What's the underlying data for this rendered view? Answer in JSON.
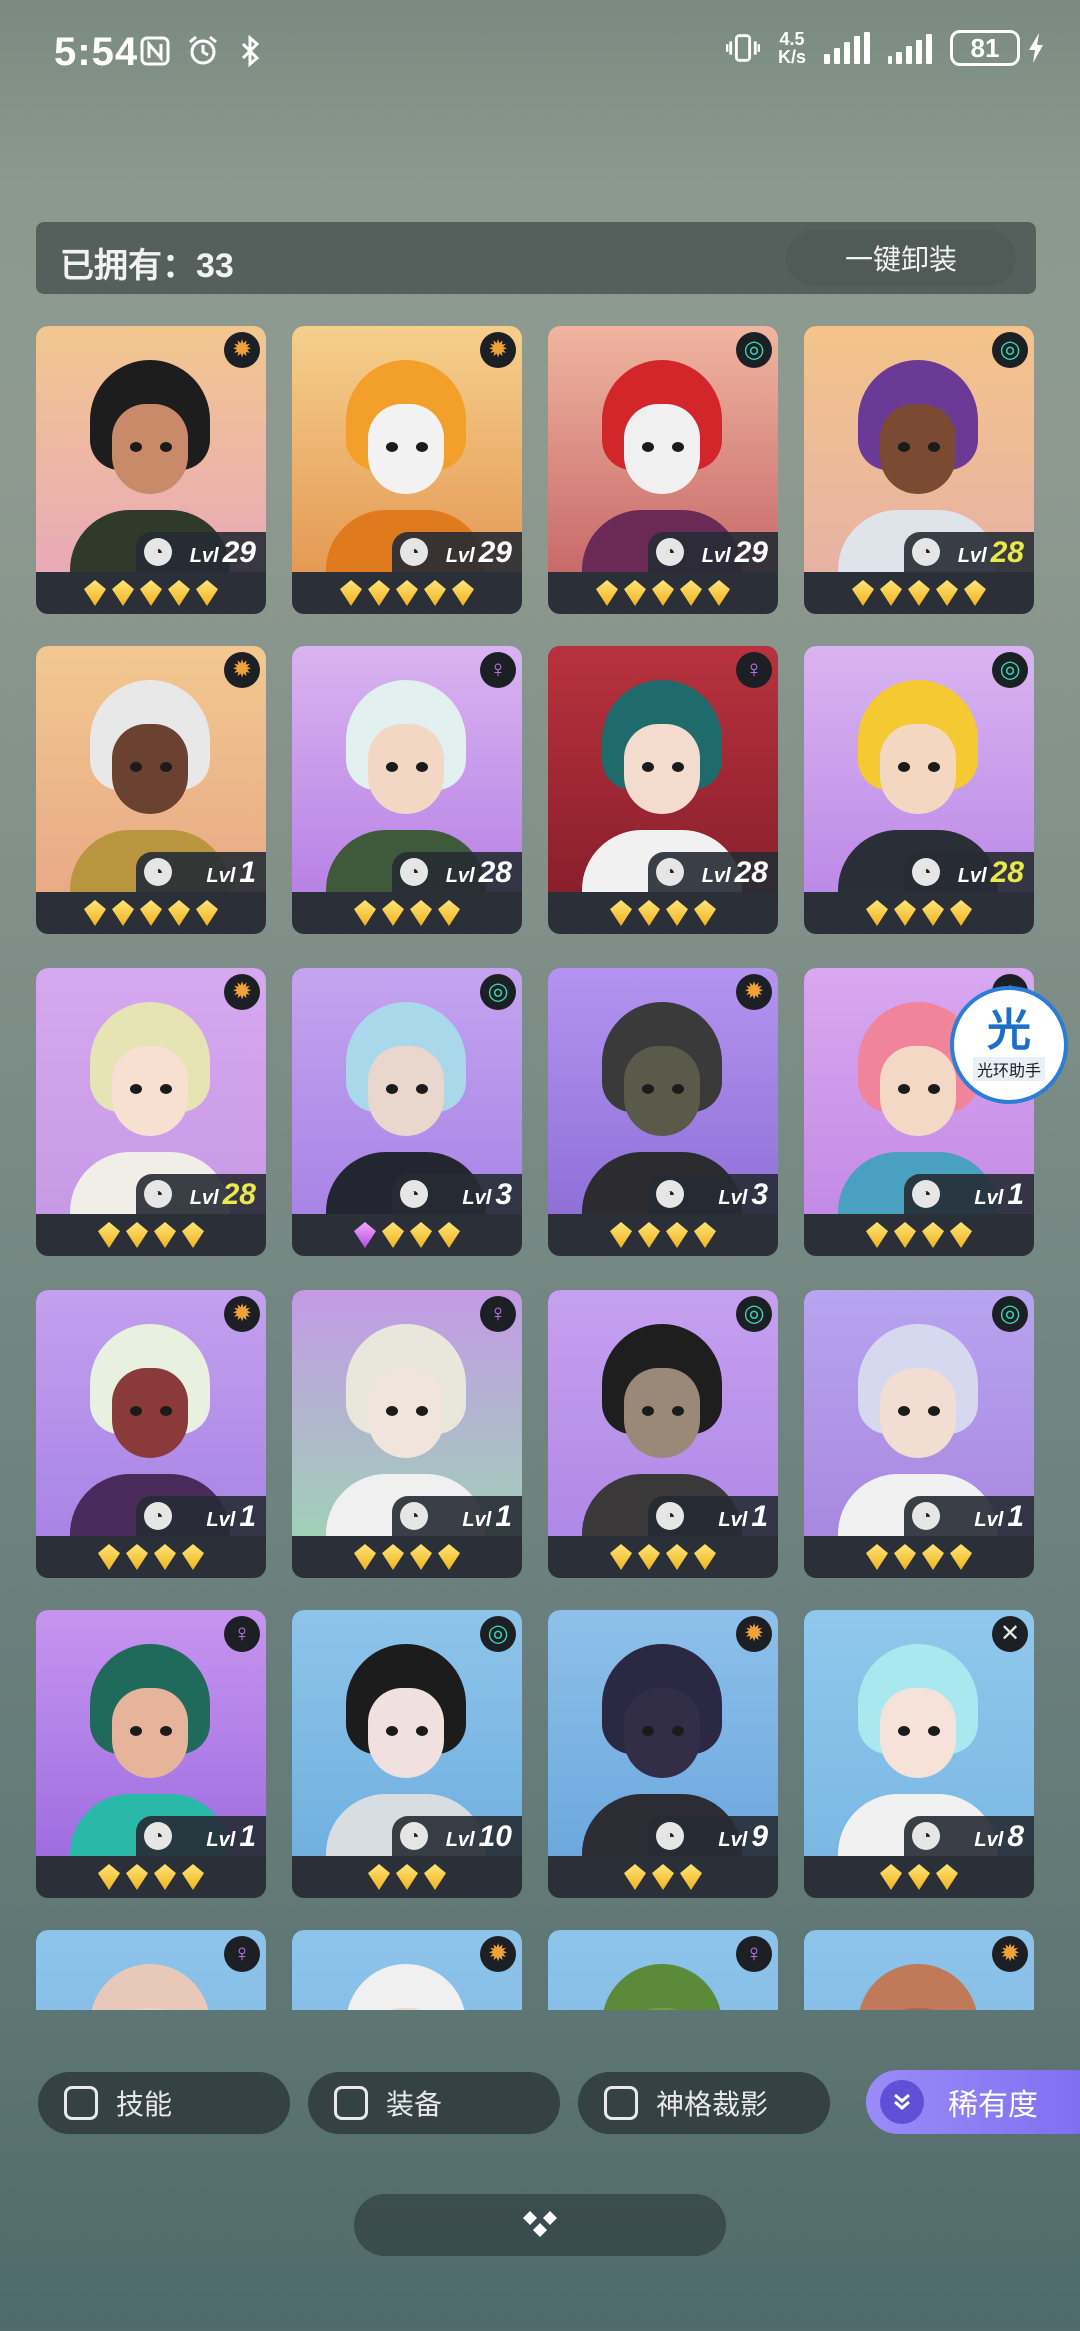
{
  "status_bar": {
    "time": "5:54",
    "net_speed_value": "4.5",
    "net_speed_unit": "K/s",
    "battery": "81",
    "icons": [
      "nfc-icon",
      "alarm-icon",
      "bluetooth-icon",
      "vibrate-icon",
      "signal-icon",
      "signal-icon",
      "charging-icon"
    ]
  },
  "header": {
    "owned_label": "已拥有：33",
    "unequip_label": "一键卸装"
  },
  "colors": {
    "element_sun": "#f0a238",
    "element_wind": "#34d6b4",
    "element_spirit": "#c47bf0",
    "element_x": "#e6e6e6",
    "level_gold": "#e8e94a",
    "rarity_button": "#8a7cf4"
  },
  "cards": [
    {
      "level_prefix": "Lvl",
      "level": "29",
      "element": "sun",
      "stars": 5,
      "purple_stars": 0,
      "gold": false,
      "bg": [
        "#f2c78e",
        "#e9a9b8"
      ],
      "hair": "#1d1d1d",
      "skin": "#c98a6a",
      "body": "#2f3a2a"
    },
    {
      "level_prefix": "Lvl",
      "level": "29",
      "element": "sun",
      "stars": 5,
      "purple_stars": 0,
      "gold": false,
      "bg": [
        "#f6cf8c",
        "#e49a55"
      ],
      "hair": "#f3a02a",
      "skin": "#f2f2f2",
      "body": "#e07a1f"
    },
    {
      "level_prefix": "Lvl",
      "level": "29",
      "element": "wind",
      "stars": 5,
      "purple_stars": 0,
      "gold": false,
      "bg": [
        "#f0b5a0",
        "#c86a6a"
      ],
      "hair": "#d3262b",
      "skin": "#f0f0f0",
      "body": "#6a2a55"
    },
    {
      "level_prefix": "Lvl",
      "level": "28",
      "element": "wind",
      "stars": 5,
      "purple_stars": 0,
      "gold": true,
      "bg": [
        "#f4c48a",
        "#e7b2a4"
      ],
      "hair": "#6b3a96",
      "skin": "#7a4a32",
      "body": "#dfe3ea"
    },
    {
      "level_prefix": "Lvl",
      "level": "1",
      "element": "sun",
      "stars": 5,
      "purple_stars": 0,
      "gold": false,
      "bg": [
        "#f2c890",
        "#e9aa86"
      ],
      "hair": "#e8e8e8",
      "skin": "#6b4232",
      "body": "#b99540"
    },
    {
      "level_prefix": "Lvl",
      "level": "28",
      "element": "spirit",
      "stars": 4,
      "purple_stars": 0,
      "gold": false,
      "bg": [
        "#d9b4f0",
        "#b882e6"
      ],
      "hair": "#e2f0f0",
      "skin": "#f2d7c4",
      "body": "#3f5a3a"
    },
    {
      "level_prefix": "Lvl",
      "level": "28",
      "element": "spirit",
      "stars": 4,
      "purple_stars": 0,
      "gold": false,
      "bg": [
        "#b8323e",
        "#8a1f2c"
      ],
      "hair": "#1f6a6a",
      "skin": "#f3dccd",
      "body": "#f1f1f1"
    },
    {
      "level_prefix": "Lvl",
      "level": "28",
      "element": "wind",
      "stars": 4,
      "purple_stars": 0,
      "gold": true,
      "bg": [
        "#d9b4f0",
        "#bc8ae8"
      ],
      "hair": "#f5c932",
      "skin": "#f4d7c0",
      "body": "#2a2e36"
    },
    {
      "level_prefix": "Lvl",
      "level": "28",
      "element": "sun",
      "stars": 4,
      "purple_stars": 0,
      "gold": true,
      "bg": [
        "#d6a8f0",
        "#c89ae6"
      ],
      "hair": "#e6e3b4",
      "skin": "#f7e0d2",
      "body": "#f0eee6"
    },
    {
      "level_prefix": "Lvl",
      "level": "3",
      "element": "wind",
      "stars": 3,
      "purple_stars": 1,
      "gold": false,
      "bg": [
        "#c4a4f0",
        "#a884e6"
      ],
      "hair": "#a9d8ea",
      "skin": "#e9d6cc",
      "body": "#232630"
    },
    {
      "level_prefix": "Lvl",
      "level": "3",
      "element": "sun",
      "stars": 4,
      "purple_stars": 0,
      "gold": false,
      "bg": [
        "#b494f0",
        "#8f70d8"
      ],
      "hair": "#3a3a3a",
      "skin": "#5a5a4a",
      "body": "#2c2c30"
    },
    {
      "level_prefix": "Lvl",
      "level": "1",
      "element": "spirit",
      "stars": 4,
      "purple_stars": 0,
      "gold": false,
      "bg": [
        "#d9a8f0",
        "#c48ae6"
      ],
      "hair": "#f0849a",
      "skin": "#f3d8c6",
      "body": "#4aa0c0"
    },
    {
      "level_prefix": "Lvl",
      "level": "1",
      "element": "sun",
      "stars": 4,
      "purple_stars": 0,
      "gold": false,
      "bg": [
        "#c4a0f0",
        "#a884e6"
      ],
      "hair": "#e8f0e0",
      "skin": "#8a3a3a",
      "body": "#4a2a5a"
    },
    {
      "level_prefix": "Lvl",
      "level": "1",
      "element": "spirit",
      "stars": 4,
      "purple_stars": 0,
      "gold": false,
      "bg": [
        "#c49ae6",
        "#a0d0b8"
      ],
      "hair": "#e9e7dc",
      "skin": "#f0e4dc",
      "body": "#f0f0f0"
    },
    {
      "level_prefix": "Lvl",
      "level": "1",
      "element": "wind",
      "stars": 4,
      "purple_stars": 0,
      "gold": false,
      "bg": [
        "#c6a0f0",
        "#b088e6"
      ],
      "hair": "#1e1e1e",
      "skin": "#9a8878",
      "body": "#3a3838"
    },
    {
      "level_prefix": "Lvl",
      "level": "1",
      "element": "wind",
      "stars": 4,
      "purple_stars": 0,
      "gold": false,
      "bg": [
        "#b8a4f0",
        "#a888e0"
      ],
      "hair": "#d6d8f0",
      "skin": "#f2ddd2",
      "body": "#f1f1f1"
    },
    {
      "level_prefix": "Lvl",
      "level": "1",
      "element": "spirit",
      "stars": 4,
      "purple_stars": 0,
      "gold": false,
      "bg": [
        "#c894f0",
        "#9e6ee0"
      ],
      "hair": "#1f6a5a",
      "skin": "#e6b49a",
      "body": "#2ab8a8"
    },
    {
      "level_prefix": "Lvl",
      "level": "10",
      "element": "wind",
      "stars": 3,
      "purple_stars": 0,
      "gold": false,
      "bg": [
        "#8ec4ea",
        "#70b0e0"
      ],
      "hair": "#1c1c1c",
      "skin": "#f0e0e0",
      "body": "#d8dde2"
    },
    {
      "level_prefix": "Lvl",
      "level": "9",
      "element": "sun",
      "stars": 3,
      "purple_stars": 0,
      "gold": false,
      "bg": [
        "#8ec0ea",
        "#6ca8de"
      ],
      "hair": "#2a2842",
      "skin": "#322e48",
      "body": "#2c2c34"
    },
    {
      "level_prefix": "Lvl",
      "level": "8",
      "element": "x",
      "stars": 3,
      "purple_stars": 0,
      "gold": false,
      "bg": [
        "#90c8ec",
        "#7ab8e4"
      ],
      "hair": "#a8e8ee",
      "skin": "#f6e2d8",
      "body": "#f1f1f1"
    },
    {
      "level_prefix": "",
      "level": "",
      "element": "spirit",
      "stars": 0,
      "purple_stars": 0,
      "gold": false,
      "bg": [
        "#8ec4ea",
        "#7ab4e2"
      ],
      "hair": "#e8c8b8",
      "skin": "#f0d0c0",
      "body": "#8ec4ea"
    },
    {
      "level_prefix": "",
      "level": "",
      "element": "sun",
      "stars": 0,
      "purple_stars": 0,
      "gold": false,
      "bg": [
        "#8ec4ea",
        "#7ab4e2"
      ],
      "hair": "#f0f0f0",
      "skin": "#f0d8c8",
      "body": "#8ec4ea"
    },
    {
      "level_prefix": "",
      "level": "",
      "element": "spirit",
      "stars": 0,
      "purple_stars": 0,
      "gold": false,
      "bg": [
        "#8ec4ea",
        "#7ab4e2"
      ],
      "hair": "#5a8a3a",
      "skin": "#7a9a4a",
      "body": "#8ec4ea"
    },
    {
      "level_prefix": "",
      "level": "",
      "element": "sun",
      "stars": 0,
      "purple_stars": 0,
      "gold": false,
      "bg": [
        "#8ec4ea",
        "#7ab4e2"
      ],
      "hair": "#c07a5a",
      "skin": "#a86a4a",
      "body": "#8ec4ea"
    }
  ],
  "watermark": {
    "big": "光",
    "small": "光环助手"
  },
  "filters": {
    "skill": "技能",
    "equipment": "装备",
    "divine": "神格裁影",
    "rarity": "稀有度"
  },
  "bottom_handle_icon": "diamond-cluster-icon"
}
